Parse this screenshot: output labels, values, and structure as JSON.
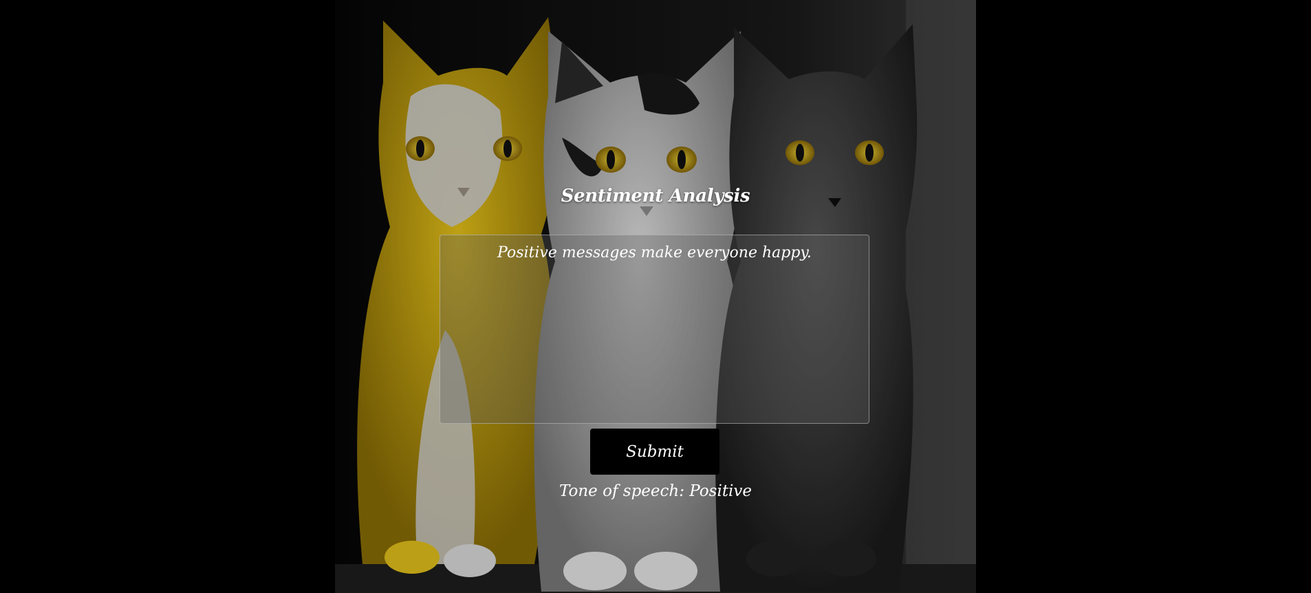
{
  "page": {
    "title": "Sentiment Analysis"
  },
  "form": {
    "input_value": "Positive messages make everyone happy.",
    "submit_label": "Submit"
  },
  "result": {
    "text": "Tone of speech: Positive"
  },
  "background": {
    "description_icon": "three-kittens-image",
    "colors": {
      "page": "#000000",
      "accent_yellow": "#e6b800",
      "eyes": "#d9b51c"
    }
  }
}
